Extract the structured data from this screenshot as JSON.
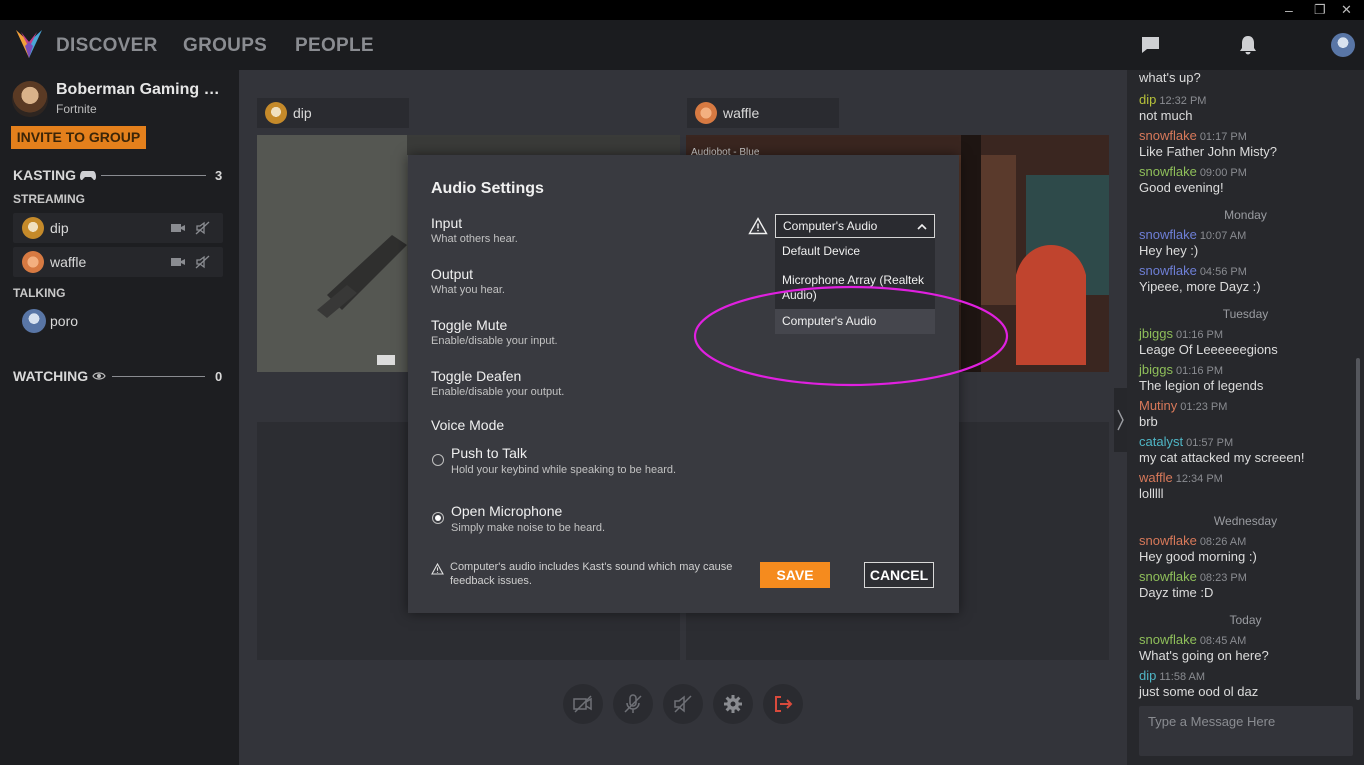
{
  "window": {
    "restore_glyph": "❐",
    "close_glyph": "✕"
  },
  "nav": {
    "items": [
      "DISCOVER",
      "GROUPS",
      "PEOPLE"
    ]
  },
  "colors": {
    "accent": "#e4801c",
    "save": "#f58b1e",
    "annotation": "#e020e0"
  },
  "sidebar": {
    "group_name": "Boberman Gaming Party",
    "game": "Fortnite",
    "invite_label": "INVITE TO GROUP",
    "kasting_label": "KASTING",
    "kasting_count": "3",
    "streaming_label": "STREAMING",
    "streamers": [
      "dip",
      "waffle"
    ],
    "talking_label": "TALKING",
    "talkers": [
      "poro"
    ],
    "watching_label": "WATCHING",
    "watching_count": "0"
  },
  "videos": {
    "tile1_name": "dip",
    "tile2_name": "waffle",
    "tile2_overlay": "Audiobot - Blue"
  },
  "modal": {
    "title": "Audio Settings",
    "input_label": "Input",
    "input_sub": "What others hear.",
    "output_label": "Output",
    "output_sub": "What you hear.",
    "mute_label": "Toggle Mute",
    "mute_sub": "Enable/disable your input.",
    "deafen_label": "Toggle Deafen",
    "deafen_sub": "Enable/disable your output.",
    "voice_mode_label": "Voice Mode",
    "ptt_label": "Push to Talk",
    "ptt_sub": "Hold your keybind while speaking to be heard.",
    "open_label": "Open Microphone",
    "open_sub": "Simply make noise to be heard.",
    "selected_voice_mode": "Open Microphone",
    "note": "Computer's audio includes Kast's sound which may cause feedback issues.",
    "save_label": "SAVE",
    "cancel_label": "CANCEL",
    "input_select_value": "Computer's Audio",
    "input_options": [
      "Default Device",
      "Microphone Array (Realtek Audio)",
      "Computer's Audio"
    ]
  },
  "chat": {
    "messages": [
      {
        "kind": "text",
        "text": "what's up?"
      },
      {
        "kind": "msg",
        "user": "dip",
        "time": "12:32 PM",
        "text": "not much",
        "color": "#b7c23a"
      },
      {
        "kind": "msg",
        "user": "snowflake",
        "time": "01:17 PM",
        "text": "Like Father John Misty?",
        "color": "#d8795a"
      },
      {
        "kind": "msg",
        "user": "snowflake",
        "time": "09:00 PM",
        "text": "Good evening!",
        "color": "#8fbf5a"
      },
      {
        "kind": "day",
        "text": "Monday"
      },
      {
        "kind": "msg",
        "user": "snowflake",
        "time": "10:07 AM",
        "text": "Hey hey :)",
        "color": "#6e7fd6"
      },
      {
        "kind": "msg",
        "user": "snowflake",
        "time": "04:56 PM",
        "text": "Yipeee, more Dayz :)",
        "color": "#6e7fd6"
      },
      {
        "kind": "day",
        "text": "Tuesday"
      },
      {
        "kind": "msg",
        "user": "jbiggs",
        "time": "01:16 PM",
        "text": "Leage Of Leeeeeegions",
        "color": "#8fbf5a"
      },
      {
        "kind": "msg",
        "user": "jbiggs",
        "time": "01:16 PM",
        "text": "The legion of legends",
        "color": "#8fbf5a"
      },
      {
        "kind": "msg",
        "user": "Mutiny",
        "time": "01:23 PM",
        "text": "brb",
        "color": "#d8795a"
      },
      {
        "kind": "msg",
        "user": "catalyst",
        "time": "01:57 PM",
        "text": "my cat attacked my screeen!",
        "color": "#4fb6c6"
      },
      {
        "kind": "msg",
        "user": "waffle",
        "time": "12:34 PM",
        "text": "lolllll",
        "color": "#d8795a"
      },
      {
        "kind": "day",
        "text": "Wednesday"
      },
      {
        "kind": "msg",
        "user": "snowflake",
        "time": "08:26 AM",
        "text": "Hey good morning :)",
        "color": "#d8795a"
      },
      {
        "kind": "msg",
        "user": "snowflake",
        "time": "08:23 PM",
        "text": "Dayz time :D",
        "color": "#8fbf5a"
      },
      {
        "kind": "day",
        "text": "Today"
      },
      {
        "kind": "msg",
        "user": "snowflake",
        "time": "08:45 AM",
        "text": "What's going on here?",
        "color": "#8fbf5a"
      },
      {
        "kind": "msg",
        "user": "dip",
        "time": "11:58 AM",
        "text": "just some ood ol daz",
        "color": "#4fb6c6"
      }
    ],
    "input_placeholder": "Type a Message Here"
  }
}
